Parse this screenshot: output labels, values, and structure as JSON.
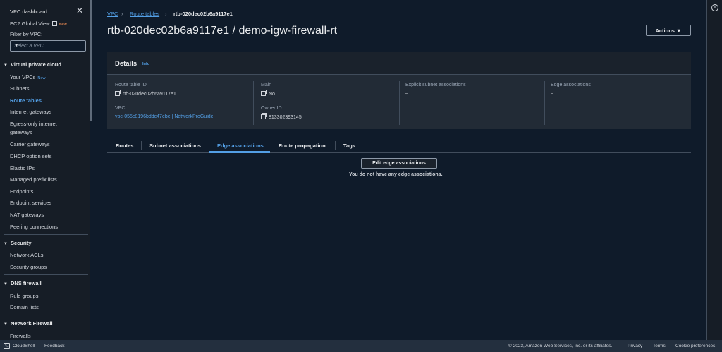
{
  "sidebar": {
    "title": "VPC dashboard",
    "close_icon": "close-icon",
    "global_view": "EC2 Global View",
    "global_view_badge": "New",
    "filter_label": "Filter by VPC:",
    "filter_placeholder": "Select a VPC",
    "sections": {
      "vpc": "Virtual private cloud",
      "security": "Security",
      "dns": "DNS firewall",
      "nfw": "Network Firewall"
    },
    "items": {
      "your_vpcs": "Your VPCs",
      "your_vpcs_badge": "New",
      "subnets": "Subnets",
      "route_tables": "Route tables",
      "internet_gateways": "Internet gateways",
      "egress_1": "Egress-only internet",
      "egress_2": "gateways",
      "carrier": "Carrier gateways",
      "dhcp": "DHCP option sets",
      "elastic_ips": "Elastic IPs",
      "prefix_lists": "Managed prefix lists",
      "endpoints": "Endpoints",
      "endpoint_services": "Endpoint services",
      "nat": "NAT gateways",
      "peering": "Peering connections",
      "nacls": "Network ACLs",
      "security_groups": "Security groups",
      "rule_groups": "Rule groups",
      "domain_lists": "Domain lists",
      "firewalls": "Firewalls"
    }
  },
  "breadcrumb": {
    "vpc": "VPC",
    "route_tables": "Route tables",
    "current": "rtb-020dec02b6a9117e1"
  },
  "page": {
    "title": "rtb-020dec02b6a9117e1 / demo-igw-firewall-rt",
    "actions": "Actions"
  },
  "details": {
    "title": "Details",
    "info": "Info",
    "route_table_id_label": "Route table ID",
    "route_table_id": "rtb-020dec02b6a9117e1",
    "main_label": "Main",
    "main": "No",
    "explicit_label": "Explicit subnet associations",
    "explicit": "–",
    "edge_label": "Edge associations",
    "edge": "–",
    "vpc_label": "VPC",
    "vpc": "vpc-055c8196bddc47ebe | NetworkProGuide",
    "owner_label": "Owner ID",
    "owner": "813302393145"
  },
  "tabs": [
    "Routes",
    "Subnet associations",
    "Edge associations",
    "Route propagation",
    "Tags"
  ],
  "edge_panel": {
    "edit_button": "Edit edge associations",
    "empty": "You do not have any edge associations."
  },
  "footer": {
    "cloudshell": "CloudShell",
    "feedback": "Feedback",
    "copyright": "© 2023, Amazon Web Services, Inc. or its affiliates.",
    "privacy": "Privacy",
    "terms": "Terms",
    "cookies": "Cookie preferences"
  },
  "colors": {
    "link": "#539fe5",
    "badge_new": "#f89256",
    "background": "#0f1b2a"
  }
}
